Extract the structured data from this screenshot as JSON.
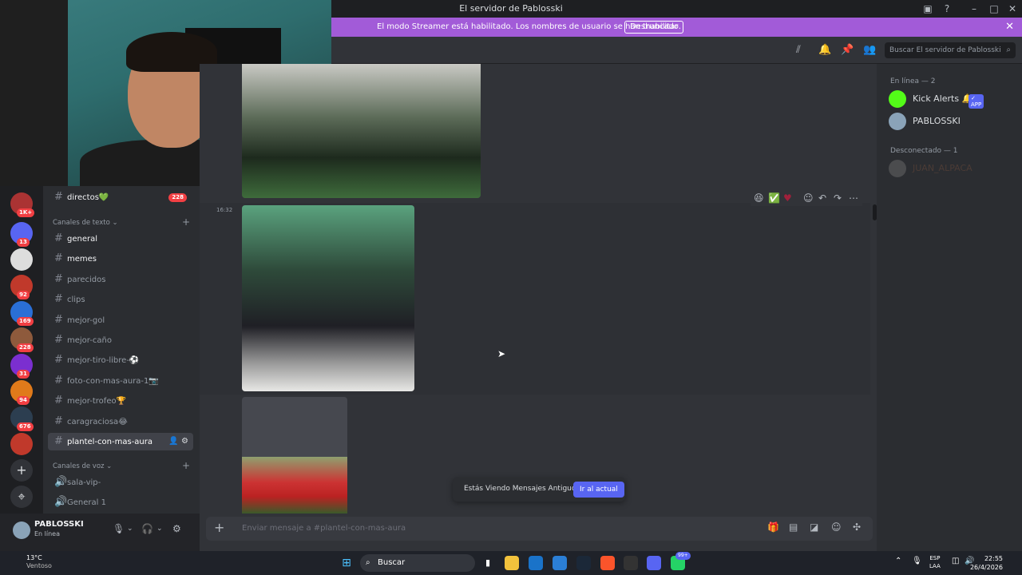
{
  "window": {
    "title": "El servidor de Pablosski"
  },
  "streamer_banner": {
    "text": "El modo Streamer está habilitado. Los nombres de usuario se han truncado.",
    "button": "Deshabilitar"
  },
  "guilds": [
    {
      "badge": "1K+",
      "color": "#a33"
    },
    {
      "badge": "13",
      "color": "#5865f2"
    },
    {
      "badge": "",
      "color": "#ddd"
    },
    {
      "badge": "92",
      "color": "#c0392b"
    },
    {
      "badge": "169",
      "color": "#2a6fd6"
    },
    {
      "badge": "228",
      "color": "#8e5a3c"
    },
    {
      "badge": "31",
      "color": "#7b2fd0"
    },
    {
      "badge": "94",
      "color": "#e07a1a"
    },
    {
      "badge": "676",
      "color": "#2c3e50"
    },
    {
      "badge": "",
      "color": "#c0392b"
    }
  ],
  "channels": {
    "top": {
      "name": "directos💚",
      "badge": "228"
    },
    "text_category": "Canales de texto",
    "text": [
      {
        "name": "general",
        "bold": true
      },
      {
        "name": "memes",
        "bold": true
      },
      {
        "name": "parecidos",
        "bold": false
      },
      {
        "name": "clips",
        "bold": false
      },
      {
        "name": "mejor-gol",
        "bold": false
      },
      {
        "name": "mejor-caño",
        "bold": false
      },
      {
        "name": "mejor-tiro-libre-⚽",
        "bold": false
      },
      {
        "name": "foto-con-mas-aura-1📷",
        "bold": false
      },
      {
        "name": "mejor-trofeo🏆",
        "bold": false
      },
      {
        "name": "caragraciosa😂",
        "bold": false
      },
      {
        "name": "plantel-con-mas-aura",
        "bold": true,
        "active": true
      }
    ],
    "voice_category": "Canales de voz",
    "voice": [
      {
        "name": "sala-vip-"
      },
      {
        "name": "General 1"
      }
    ]
  },
  "user": {
    "name": "PABLOSSKI",
    "status": "En línea"
  },
  "header": {
    "search_placeholder": "Buscar El servidor de Pablosski"
  },
  "messages": {
    "timestamp": "16:32"
  },
  "old_messages": {
    "text": "Estás Viendo Mensajes Antiguos",
    "button": "Ir al actual"
  },
  "composer": {
    "placeholder": "Enviar mensaje a #plantel-con-mas-aura"
  },
  "members": {
    "online_header": "En línea — 2",
    "offline_header": "Desconectado — 1",
    "online": [
      {
        "name": "Kick Alerts 🔔",
        "tag": "✓ APP",
        "color": "#dbdee1",
        "avatar": "#53fc18"
      },
      {
        "name": "PABLOSSKI",
        "tag": "",
        "color": "#dbdee1",
        "avatar": "#8aa3b8"
      }
    ],
    "offline": [
      {
        "name": "JUAN_ALPACA",
        "color": "#6b4a3a",
        "avatar": "#6b6b6b"
      }
    ]
  },
  "taskbar": {
    "temp": "13°C",
    "weather": "Ventoso",
    "search": "Buscar",
    "lang1": "ESP",
    "lang2": "LAA",
    "time": "22:55",
    "date": "26/4/2026",
    "discord_badge": "99+"
  }
}
